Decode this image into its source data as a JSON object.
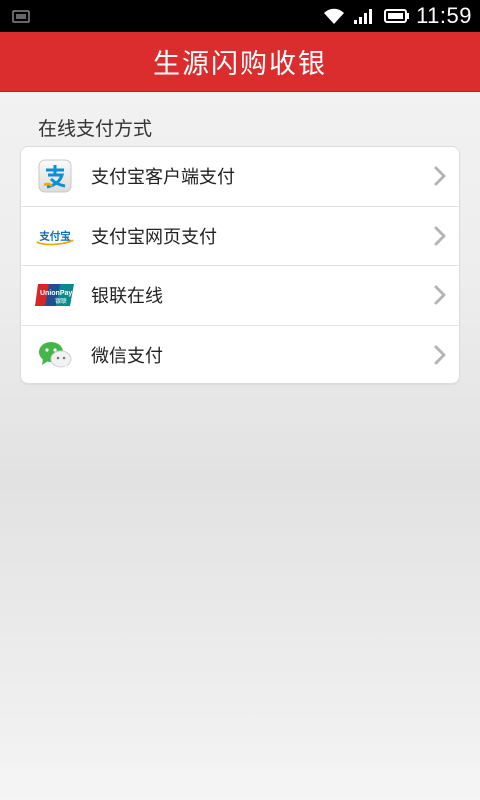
{
  "status_bar": {
    "time": "11:59",
    "icons": [
      "notification-icon",
      "wifi-icon",
      "signal-icon",
      "battery-icon"
    ]
  },
  "header": {
    "title": "生源闪购收银",
    "color": "#db2d2e"
  },
  "section": {
    "title": "在线支付方式"
  },
  "payment_methods": [
    {
      "label": "支付宝客户端支付",
      "icon": "alipay-client-icon"
    },
    {
      "label": "支付宝网页支付",
      "icon": "alipay-web-icon"
    },
    {
      "label": "银联在线",
      "icon": "unionpay-icon"
    },
    {
      "label": "微信支付",
      "icon": "wechat-pay-icon"
    }
  ]
}
